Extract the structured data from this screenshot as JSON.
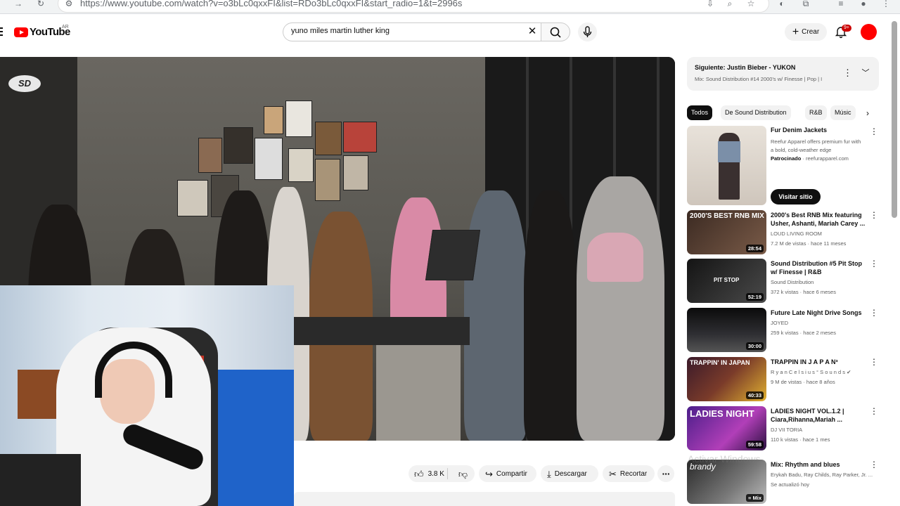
{
  "browser": {
    "url": "https://www.youtube.com/watch?v=o3bLc0qxxFI&list=RDo3bLc0qxxFI&start_radio=1&t=2996s"
  },
  "header": {
    "logo_text": "YouTube",
    "country_code": "AR",
    "search_value": "yuno miles martin luther king",
    "create_label": "Crear",
    "notification_count": "9+"
  },
  "video": {
    "channel_watermark": "SD"
  },
  "actions": {
    "like_count": "3.8 K",
    "share_label": "Compartir",
    "download_label": "Descargar",
    "clip_label": "Recortar"
  },
  "sidebar": {
    "next_title": "Siguiente: Justin Bieber - YUKON",
    "next_subtitle": "Mix: Sound Distribution #14 2000's w/ Finesse | Pop | I",
    "chips": [
      "Todos",
      "De Sound Distribution",
      "R&B",
      "Músic"
    ],
    "ad": {
      "title": "Fur Denim Jackets",
      "description": "Reefur Apparel offers premium fur with a bold, cold-weather edge",
      "sponsored_label": "Patrocinado",
      "domain": "reefurapparel.com",
      "button": "Visitar sitio"
    },
    "items": [
      {
        "title": "2000's Best RNB Mix featuring Usher, Ashanti, Mariah Carey ...",
        "channel": "LOUD LIVING ROOM",
        "meta": "7.2 M de vistas · hace 11 meses",
        "duration": "28:54",
        "thumb_text": "2000'S BEST RNB MIX"
      },
      {
        "title": "Sound Distribution #5 Pit Stop w/ Finesse | R&B",
        "channel": "Sound Distribution",
        "meta": "372 k vistas · hace 6 meses",
        "duration": "52:19",
        "thumb_text": "PIT STOP"
      },
      {
        "title": "Future Late Night Drive Songs",
        "channel": "JOYED",
        "meta": "259 k vistas · hace 2 meses",
        "duration": "30:00",
        "thumb_text": ""
      },
      {
        "title": "TRAPPIN IN J A P A N³",
        "channel": "R y a n C e l s i u s ° S o u n d s",
        "meta": "9 M de vistas · hace 8 años",
        "duration": "40:33",
        "thumb_text": "TRAPPIN' IN JAPAN"
      },
      {
        "title": "LADIES NIGHT VOL.1.2 | Ciara,Rihanna,Mariah ...",
        "channel": "DJ VII TORIA",
        "meta": "110 k vistas · hace 1 mes",
        "duration": "59:58",
        "thumb_text": "LADIES NIGHT"
      },
      {
        "title": "Mix: Rhythm and blues",
        "channel": "Erykah Badu, Ray Childs, Ray Parker, Jr. ...",
        "meta": "Se actualizó hoy",
        "duration": "Mix",
        "thumb_text": "brandy"
      }
    ]
  },
  "watermark": "Activar Windows"
}
